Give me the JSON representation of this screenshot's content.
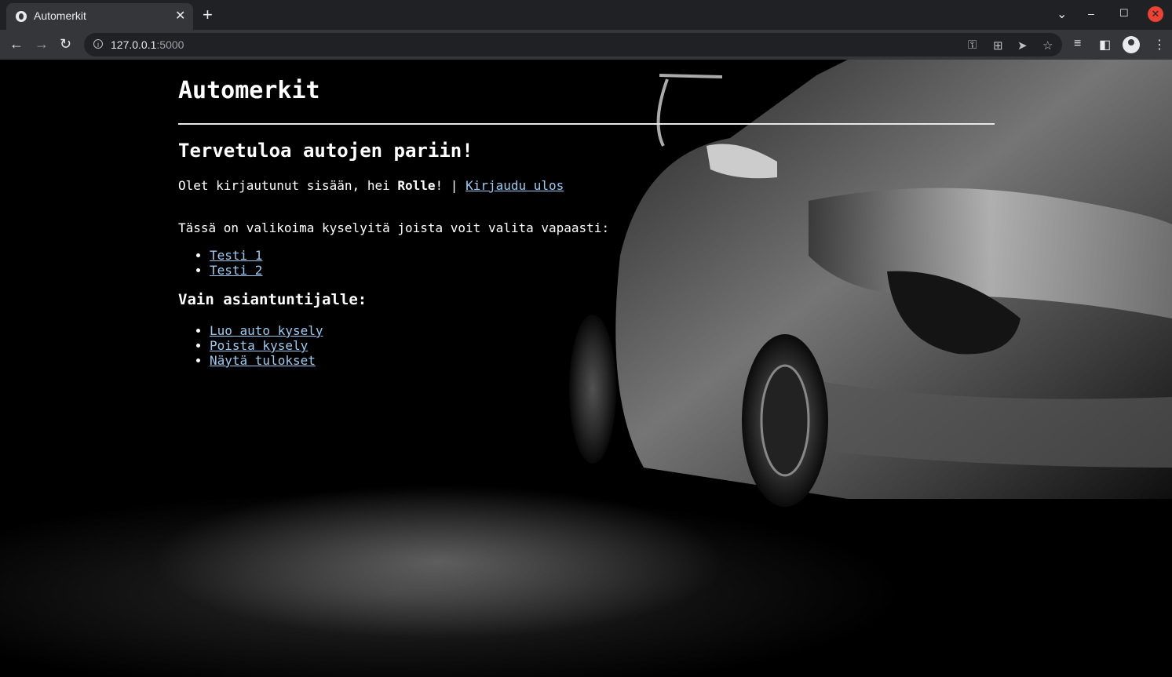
{
  "browser": {
    "tab_title": "Automerkit",
    "url_host": "127.0.0.1",
    "url_port": ":5000",
    "icons": [
      "globe-icon",
      "close-icon",
      "plus-icon",
      "chevron-down-icon",
      "minimize-icon",
      "maximize-icon",
      "back-icon",
      "forward-icon",
      "reload-icon",
      "info-icon",
      "key-icon",
      "translate-icon",
      "send-icon",
      "star-icon",
      "reading-list-icon",
      "side-panel-icon",
      "profile-icon",
      "menu-icon"
    ]
  },
  "page": {
    "site_title": "Automerkit",
    "welcome_heading": "Tervetuloa autojen pariin!",
    "login_prefix": "Olet kirjautunut sisään, hei ",
    "username": "Rolle",
    "login_suffix": "! | ",
    "logout_link": "Kirjaudu ulos",
    "intro_text": "Tässä on valikoima kyselyitä joista voit valita vapaasti:",
    "surveys": [
      "Testi 1",
      "Testi 2"
    ],
    "expert_heading": "Vain asiantuntijalle:",
    "expert_links": [
      "Luo auto kysely",
      "Poista kysely",
      "Näytä tulokset"
    ]
  },
  "colors": {
    "link": "#9ec9f0",
    "background": "#000000",
    "chrome_dark": "#202124",
    "chrome_toolbar": "#35363a",
    "close_red": "#ea4335"
  }
}
